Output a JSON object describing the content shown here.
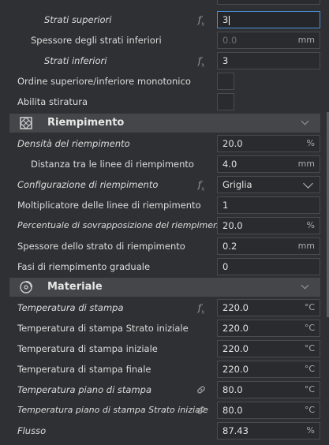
{
  "rows": {
    "strati_superiori": {
      "label": "Strati superiori",
      "value": "3"
    },
    "spessore_inferiori": {
      "label": "Spessore degli strati inferiori",
      "value": "0.0",
      "unit": "mm"
    },
    "strati_inferiori": {
      "label": "Strati inferiori",
      "value": "3"
    },
    "ordine_monotonico": {
      "label": "Ordine superiore/inferiore monotonico"
    },
    "abilita_stiratura": {
      "label": "Abilita stiratura"
    },
    "densita_riempimento": {
      "label": "Densità del riempimento",
      "value": "20.0",
      "unit": "%"
    },
    "distanza_linee": {
      "label": "Distanza tra le linee di riempimento",
      "value": "4.0",
      "unit": "mm"
    },
    "configurazione": {
      "label": "Configurazione di riempimento",
      "value": "Griglia"
    },
    "moltiplicatore": {
      "label": "Moltiplicatore delle linee di riempimento",
      "value": "1"
    },
    "sovrapposizione": {
      "label": "Percentuale di sovrapposizione del riempimento",
      "value": "20.0",
      "unit": "%"
    },
    "spessore_strato_riempimento": {
      "label": "Spessore dello strato di riempimento",
      "value": "0.2",
      "unit": "mm"
    },
    "fasi_graduale": {
      "label": "Fasi di riempimento graduale",
      "value": "0"
    },
    "temp_stampa": {
      "label": "Temperatura di stampa",
      "value": "220.0",
      "unit": "°C"
    },
    "temp_strato_iniziale": {
      "label": "Temperatura di stampa Strato iniziale",
      "value": "220.0",
      "unit": "°C"
    },
    "temp_iniziale": {
      "label": "Temperatura di stampa iniziale",
      "value": "220.0",
      "unit": "°C"
    },
    "temp_finale": {
      "label": "Temperatura di stampa finale",
      "value": "220.0",
      "unit": "°C"
    },
    "temp_piano": {
      "label": "Temperatura piano di stampa",
      "value": "80.0",
      "unit": "°C"
    },
    "temp_piano_iniziale": {
      "label": "Temperatura piano di stampa Strato iniziale",
      "value": "80.0",
      "unit": "°C"
    },
    "flusso": {
      "label": "Flusso",
      "value": "87.43",
      "unit": "%"
    }
  },
  "sections": {
    "riempimento": {
      "title": "Riempimento",
      "icon": "infill-icon"
    },
    "materiale": {
      "title": "Materiale",
      "icon": "material-spool-icon"
    }
  },
  "icons": {
    "function": "fx",
    "link": "link-icon"
  },
  "colors": {
    "background": "#2f3033",
    "section_header": "#454649",
    "focus_border": "#4a90d9"
  }
}
